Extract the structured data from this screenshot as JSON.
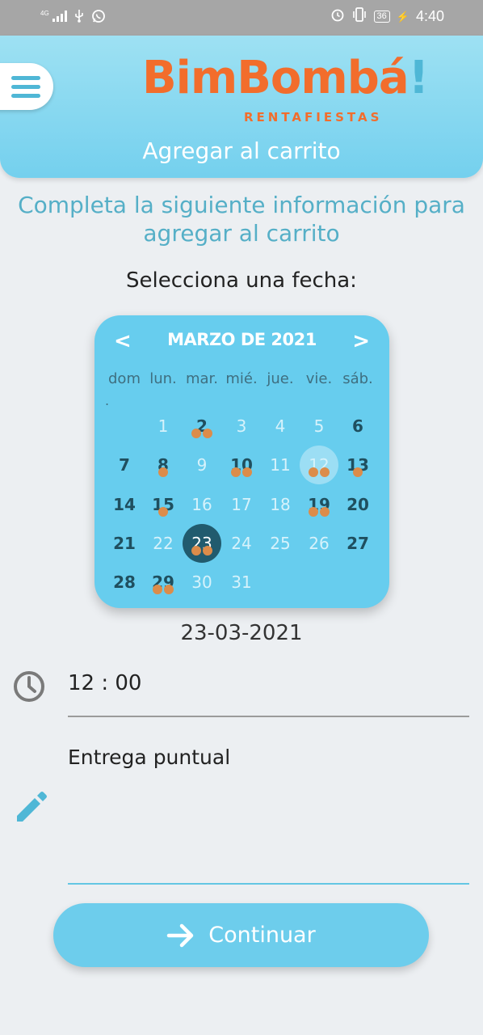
{
  "status_bar": {
    "network": "4G",
    "time": "4:40",
    "battery": "36",
    "icons": [
      "signal-icon",
      "usb-icon",
      "whatsapp-icon",
      "alarm-icon",
      "vibrate-icon",
      "battery-icon",
      "charging-icon"
    ]
  },
  "header": {
    "logo_main": "BimBombá",
    "logo_exclaim": "!",
    "logo_sub": "RENTAFIESTAS",
    "title": "Agregar al carrito",
    "menu_icon": "hamburger-menu-icon"
  },
  "instructions": "Completa la siguiente información para agregar al carrito",
  "date_prompt": "Selecciona una fecha:",
  "calendar": {
    "title": "MARZO DE 2021",
    "prev_icon": "chevron-left-icon",
    "next_icon": "chevron-right-icon",
    "weekdays": [
      "dom",
      "lun.",
      "mar.",
      "mié.",
      "jue.",
      "vie.",
      "sáb."
    ],
    "weekday_extra": ".",
    "weeks": [
      [
        "",
        "1",
        "2",
        "3",
        "4",
        "5",
        "6"
      ],
      [
        "7",
        "8",
        "9",
        "10",
        "11",
        "12",
        "13"
      ],
      [
        "14",
        "15",
        "16",
        "17",
        "18",
        "19",
        "20"
      ],
      [
        "21",
        "22",
        "23",
        "24",
        "25",
        "26",
        "27"
      ],
      [
        "28",
        "29",
        "30",
        "31",
        "",
        "",
        ""
      ]
    ],
    "today": "12",
    "selected": "23",
    "available_days": [
      "2",
      "6",
      "7",
      "8",
      "10",
      "13",
      "14",
      "15",
      "19",
      "20",
      "21",
      "27",
      "28",
      "29"
    ],
    "event_days": {
      "2": 2,
      "8": 1,
      "10": 2,
      "12": 2,
      "13": 1,
      "15": 1,
      "19": 2,
      "23": 2,
      "29": 2
    },
    "colors": {
      "background": "#67cdee",
      "selected": "#215b6e",
      "event_dot": "#dc8c4a"
    }
  },
  "selected_date": "23-03-2021",
  "time": {
    "value": "12 : 00",
    "icon": "clock-icon"
  },
  "note": {
    "value": "Entrega puntual",
    "icon": "pencil-icon"
  },
  "continue_button": {
    "label": "Continuar",
    "icon": "arrow-right-icon"
  },
  "colors": {
    "brand_orange": "#f26d2c",
    "brand_blue": "#67cdee",
    "accent_text": "#55afc7"
  }
}
